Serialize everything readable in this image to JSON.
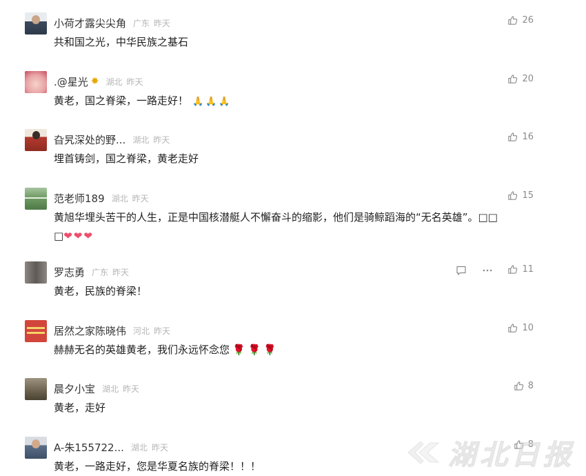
{
  "comments": [
    {
      "username": "小荷才露尖尖角",
      "region": "广东",
      "time": "昨天",
      "text": "共和国之光，中华民族之基石",
      "likes": "26",
      "avatar_color": "#3b4a5e"
    },
    {
      "username": ".@星光",
      "badge_icon": "sparkle-icon",
      "region": "湖北",
      "time": "昨天",
      "text": "黄老，国之脊梁，一路走好！",
      "emoji": "🙏🙏🙏",
      "likes": "20",
      "avatar_color": "#e6a0a6"
    },
    {
      "username": "旮旯深处的野...",
      "region": "湖北",
      "time": "昨天",
      "text": "埋首铸剑，国之脊梁，黄老走好",
      "likes": "16",
      "avatar_color": "#b33a2e"
    },
    {
      "username": "范老师189",
      "region": "湖北",
      "time": "昨天",
      "text": "黄旭华埋头苦干的人生，正是中国核潜艇人不懈奋斗的缩影，他们是骑鲸蹈海的“无名英雄”。□□",
      "text_cont": "□",
      "hearts": "❤❤❤",
      "likes": "15",
      "avatar_color": "#5e8a57"
    },
    {
      "username": "罗志勇",
      "region": "广东",
      "time": "昨天",
      "text": "黄老，民族的脊梁！",
      "likes": "11",
      "avatar_color": "#6d6a66"
    },
    {
      "username": "居然之家陈晓伟",
      "region": "河北",
      "time": "昨天",
      "text": "赫赫无名的英雄黄老，我们永远怀念您",
      "roses": "🌹🌹🌹",
      "likes": "10",
      "avatar_color": "#d2453b"
    },
    {
      "username": "晨夕小宝",
      "region": "湖北",
      "time": "昨天",
      "text": "黄老，走好",
      "likes": "8",
      "avatar_color": "#7a6e58"
    },
    {
      "username": "A-朱155722...",
      "region": "湖北",
      "time": "昨天",
      "text": "黄老，一路走好，您是华夏名族的脊梁！！！",
      "likes": "8",
      "avatar_color": "#5a6f8a"
    }
  ],
  "icons": {
    "like": "thumbs-up-icon",
    "reply": "comment-icon",
    "more": "more-icon"
  },
  "watermark": {
    "text": "湖北日报"
  },
  "colors": {
    "meta_gray": "#b5b5b5",
    "text": "#222222",
    "icon_gray": "#8a8a8a"
  }
}
